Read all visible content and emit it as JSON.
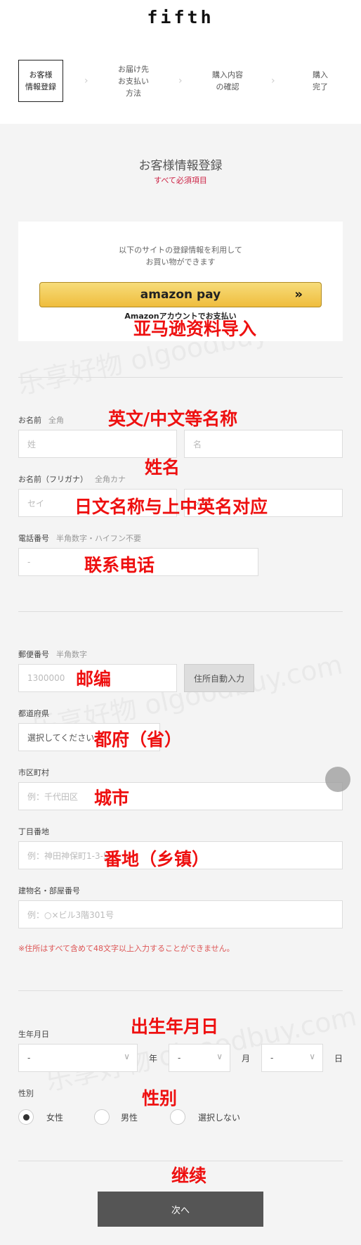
{
  "header": {
    "logo": "fifth"
  },
  "steps": [
    {
      "lines": [
        "お客様",
        "情報登録"
      ],
      "active": true
    },
    {
      "lines": [
        "お届け先",
        "お支払い",
        "方法"
      ],
      "active": false
    },
    {
      "lines": [
        "購入内容",
        "の確認"
      ],
      "active": false
    },
    {
      "lines": [
        "購入",
        "完了"
      ],
      "active": false
    }
  ],
  "section": {
    "title": "お客様情報登録",
    "subtitle": "すべて必須項目"
  },
  "amazon": {
    "line1": "以下のサイトの登録情報を利用して",
    "line2": "お買い物ができます",
    "button": "amazon pay",
    "arrow": "»",
    "caption": "Amazonアカウントでお支払い"
  },
  "form": {
    "name": {
      "label": "お名前",
      "hint": "全角",
      "last_placeholder": "姓",
      "first_placeholder": "名"
    },
    "kana": {
      "label": "お名前（フリガナ）",
      "hint": "全角カナ",
      "last_placeholder": "セイ",
      "first_placeholder": "メイ"
    },
    "phone": {
      "label": "電話番号",
      "hint": "半角数字・ハイフン不要",
      "placeholder": "-"
    },
    "zip": {
      "label": "郵便番号",
      "hint": "半角数字",
      "placeholder": "1300000",
      "button": "住所自動入力"
    },
    "prefecture": {
      "label": "都道府県",
      "selected": "選択してください"
    },
    "city": {
      "label": "市区町村",
      "placeholder": "例：千代田区"
    },
    "street": {
      "label": "丁目番地",
      "placeholder": "例：神田神保町1-3-5"
    },
    "building": {
      "label": "建物名・部屋番号",
      "placeholder": "例：○×ビル3階301号"
    },
    "address_warning": "※住所はすべて含めて48文字以上入力することができません。",
    "birthday": {
      "label": "生年月日",
      "year": "-",
      "month": "-",
      "day": "-",
      "year_unit": "年",
      "month_unit": "月",
      "day_unit": "日"
    },
    "gender": {
      "label": "性別",
      "options": [
        "女性",
        "男性",
        "選択しない"
      ],
      "selected": "女性"
    }
  },
  "next_button": "次へ",
  "annotations": {
    "amazon": "亚马逊资料导入",
    "name": "英文/中文等名称",
    "lastname": "姓名",
    "kana": "日文名称与上中英名对应",
    "phone": "联系电话",
    "zip": "邮编",
    "prefecture": "都府（省）",
    "city": "城市",
    "street": "番地（乡镇）",
    "birthday": "出生年月日",
    "gender": "性别",
    "next": "继续"
  },
  "watermark": "乐享好物 olgoodbuy.com",
  "colors": {
    "required": "#cc2244",
    "annotation": "#ee1010",
    "next_button": "#555555",
    "amazon_button": "#f0c14b"
  }
}
